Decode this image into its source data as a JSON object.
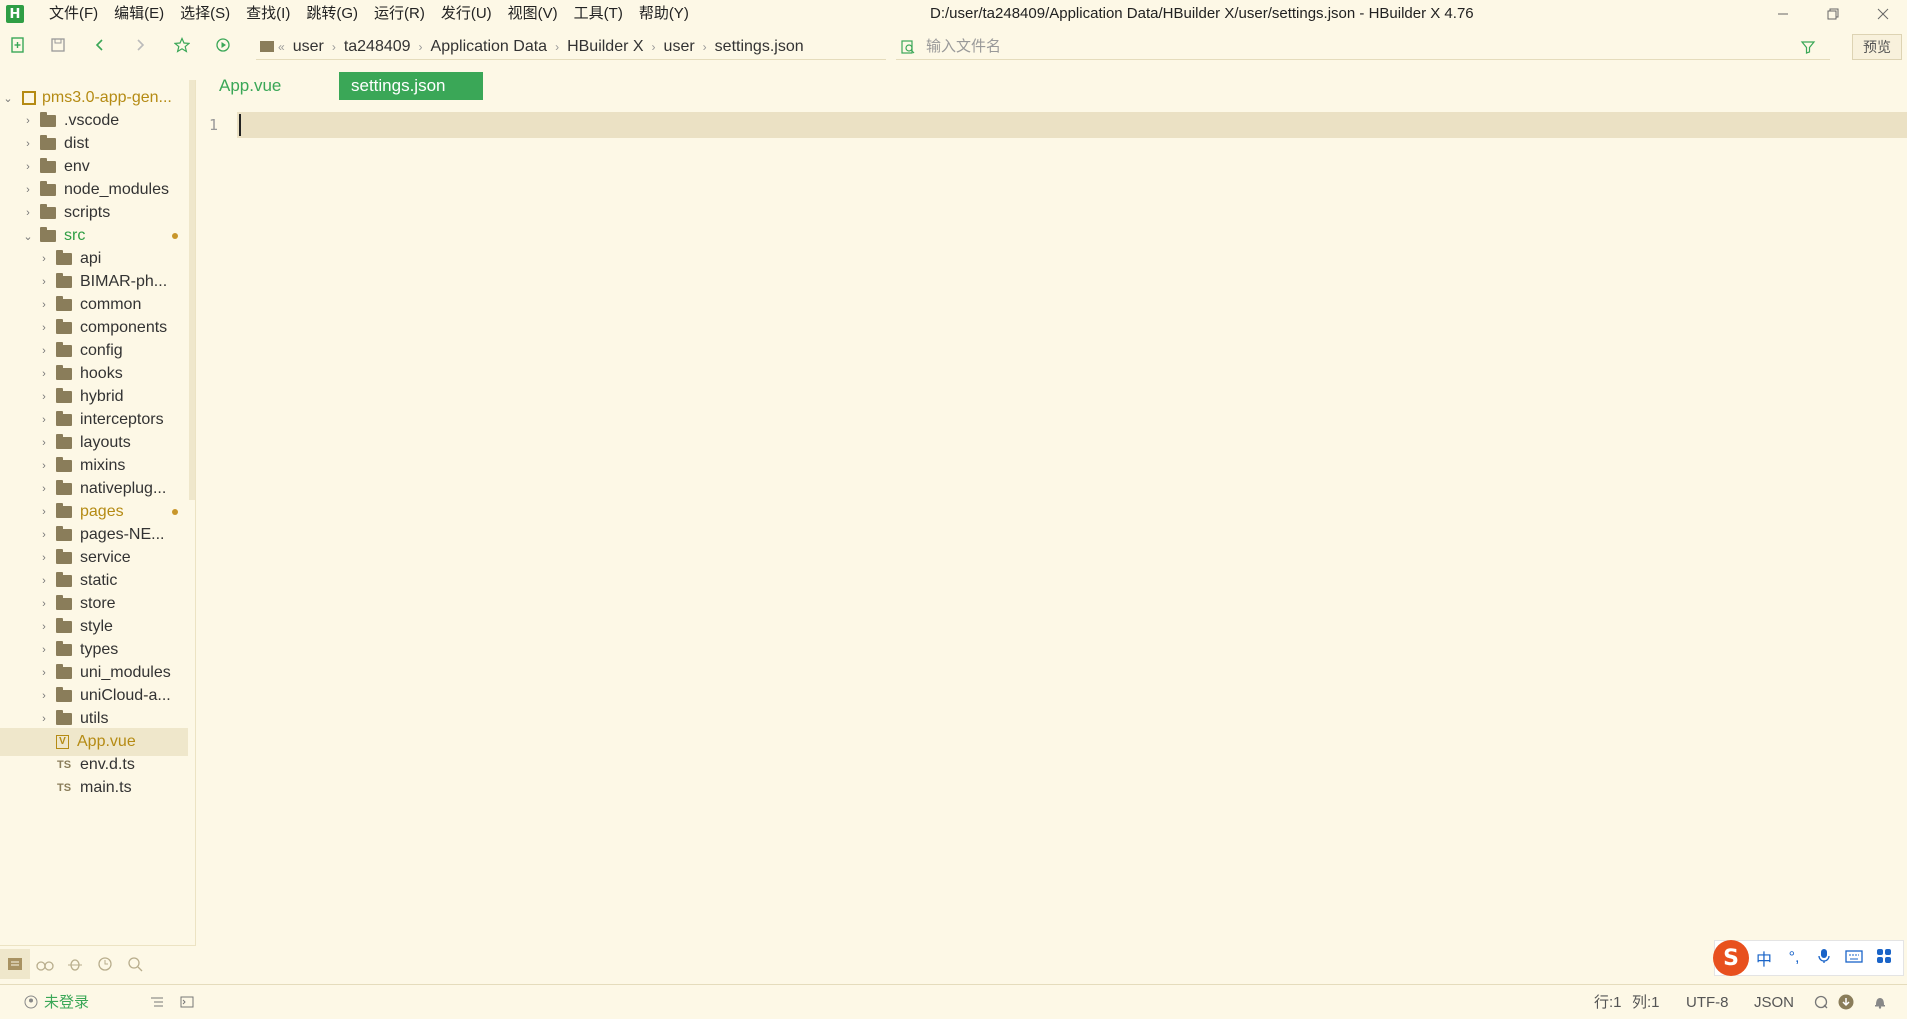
{
  "app": {
    "logo_letter": "H",
    "window_title": "D:/user/ta248409/Application Data/HBuilder X/user/settings.json - HBuilder X 4.76"
  },
  "menu": [
    {
      "label": "文件(F)"
    },
    {
      "label": "编辑(E)"
    },
    {
      "label": "选择(S)"
    },
    {
      "label": "查找(I)"
    },
    {
      "label": "跳转(G)"
    },
    {
      "label": "运行(R)"
    },
    {
      "label": "发行(U)"
    },
    {
      "label": "视图(V)"
    },
    {
      "label": "工具(T)"
    },
    {
      "label": "帮助(Y)"
    }
  ],
  "toolbar": {
    "breadcrumb": [
      "user",
      "ta248409",
      "Application Data",
      "HBuilder X",
      "user",
      "settings.json"
    ],
    "breadcrumb_prefix": "«",
    "file_search_placeholder": "输入文件名",
    "preview_label": "预览"
  },
  "explorer": {
    "project": "pms3.0-app-gen...",
    "items": [
      {
        "label": ".vscode",
        "depth": 1,
        "type": "folder",
        "expanded": false
      },
      {
        "label": "dist",
        "depth": 1,
        "type": "folder",
        "expanded": false
      },
      {
        "label": "env",
        "depth": 1,
        "type": "folder",
        "expanded": false
      },
      {
        "label": "node_modules",
        "depth": 1,
        "type": "folder",
        "expanded": false
      },
      {
        "label": "scripts",
        "depth": 1,
        "type": "folder",
        "expanded": false
      },
      {
        "label": "src",
        "depth": 1,
        "type": "folder",
        "expanded": true,
        "modified": true
      },
      {
        "label": "api",
        "depth": 2,
        "type": "folder",
        "expanded": false
      },
      {
        "label": "BIMAR-ph...",
        "depth": 2,
        "type": "folder",
        "expanded": false
      },
      {
        "label": "common",
        "depth": 2,
        "type": "folder",
        "expanded": false
      },
      {
        "label": "components",
        "depth": 2,
        "type": "folder",
        "expanded": false
      },
      {
        "label": "config",
        "depth": 2,
        "type": "folder",
        "expanded": false
      },
      {
        "label": "hooks",
        "depth": 2,
        "type": "folder",
        "expanded": false
      },
      {
        "label": "hybrid",
        "depth": 2,
        "type": "folder",
        "expanded": false
      },
      {
        "label": "interceptors",
        "depth": 2,
        "type": "folder",
        "expanded": false
      },
      {
        "label": "layouts",
        "depth": 2,
        "type": "folder",
        "expanded": false
      },
      {
        "label": "mixins",
        "depth": 2,
        "type": "folder",
        "expanded": false
      },
      {
        "label": "nativeplug...",
        "depth": 2,
        "type": "folder",
        "expanded": false
      },
      {
        "label": "pages",
        "depth": 2,
        "type": "folder",
        "expanded": false,
        "modified": true
      },
      {
        "label": "pages-NE...",
        "depth": 2,
        "type": "folder",
        "expanded": false
      },
      {
        "label": "service",
        "depth": 2,
        "type": "folder",
        "expanded": false
      },
      {
        "label": "static",
        "depth": 2,
        "type": "folder",
        "expanded": false
      },
      {
        "label": "store",
        "depth": 2,
        "type": "folder",
        "expanded": false
      },
      {
        "label": "style",
        "depth": 2,
        "type": "folder",
        "expanded": false
      },
      {
        "label": "types",
        "depth": 2,
        "type": "folder",
        "expanded": false
      },
      {
        "label": "uni_modules",
        "depth": 2,
        "type": "folder",
        "expanded": false
      },
      {
        "label": "uniCloud-a...",
        "depth": 2,
        "type": "folder",
        "expanded": false
      },
      {
        "label": "utils",
        "depth": 2,
        "type": "folder",
        "expanded": false
      },
      {
        "label": "App.vue",
        "depth": 2,
        "type": "vue",
        "selected": true
      },
      {
        "label": "env.d.ts",
        "depth": 2,
        "type": "ts"
      },
      {
        "label": "main.ts",
        "depth": 2,
        "type": "ts"
      }
    ]
  },
  "tabs": [
    {
      "label": "App.vue",
      "active": false
    },
    {
      "label": "settings.json",
      "active": true
    }
  ],
  "editor": {
    "line_numbers": [
      "1"
    ],
    "content": ""
  },
  "ime": {
    "logo": "S",
    "mode": "中",
    "punct": "°,"
  },
  "status": {
    "login": "未登录",
    "row": "行:1",
    "col": "列:1",
    "encoding": "UTF-8",
    "language": "JSON"
  },
  "colors": {
    "background": "#fdf8e6",
    "accent_green": "#2f9e44",
    "active_tab_bg": "#3aa757",
    "modified_dot": "#c8962a",
    "current_line": "#ebe1c4"
  }
}
